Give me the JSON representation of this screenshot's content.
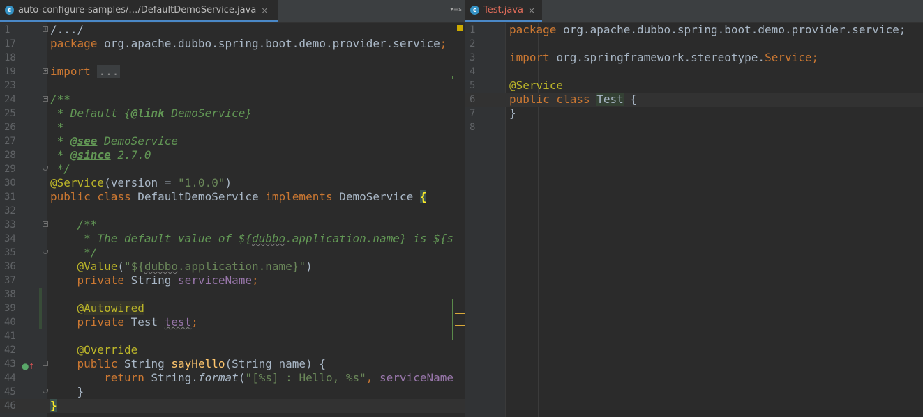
{
  "tabs": {
    "left": {
      "title": "auto-configure-samples/…/DefaultDemoService.java",
      "close": "×",
      "icon": "c-class-icon",
      "icon_label": "c"
    },
    "right": {
      "title": "Test.java",
      "close": "×",
      "icon": "c-class-icon",
      "icon_label": "c"
    },
    "menu_label": "▾≡s"
  },
  "colors": {
    "background": "#2b2b2b",
    "keyword": "#cc7832",
    "annotation": "#bbb529",
    "string": "#6a8759",
    "doc": "#629755",
    "field": "#9876aa",
    "method": "#ffc66d",
    "tab_accent": "#4a88c7"
  },
  "left_editor": {
    "lines": [
      {
        "n": "1",
        "t": "/.../"
      },
      {
        "n": "17",
        "t": "org.apache.dubbo.spring.boot.demo.provider.service",
        "kw": "package "
      },
      {
        "n": "18",
        "t": ""
      },
      {
        "n": "19",
        "kw": "import ",
        "t": "..."
      },
      {
        "n": "23",
        "t": ""
      },
      {
        "n": "24",
        "t": "/**"
      },
      {
        "n": "25",
        "pre": " * Default {",
        "tag": "@link",
        "post": " DemoService}"
      },
      {
        "n": "26",
        "t": " *"
      },
      {
        "n": "27",
        "pre": " * ",
        "tag": "@see",
        "post": " DemoService"
      },
      {
        "n": "28",
        "pre": " * ",
        "tag": "@since",
        "post": " 2.7.0"
      },
      {
        "n": "29",
        "t": " */"
      },
      {
        "n": "30",
        "ann": "@Service",
        "a": "(version = ",
        "str": "\"1.0.0\"",
        "b": ")"
      },
      {
        "n": "31",
        "kw1": "public class ",
        "name": "DefaultDemoService ",
        "kw2": "implements ",
        "iface": "DemoService ",
        "brace": "{"
      },
      {
        "n": "32",
        "t": ""
      },
      {
        "n": "33",
        "t": "    /**"
      },
      {
        "n": "34",
        "pre": "     * The default value of ${",
        "wv": "dubbo",
        "post": ".application.name} is ${s"
      },
      {
        "n": "35",
        "t": "     */"
      },
      {
        "n": "36",
        "ind": "    ",
        "ann": "@Value",
        "a": "(",
        "s1": "\"${",
        "sw": "dubbo",
        "s2": ".application.name}\"",
        "b": ")"
      },
      {
        "n": "37",
        "ind": "    ",
        "kw": "private ",
        "type": "String ",
        "fld": "serviceName",
        "end": ";"
      },
      {
        "n": "38",
        "t": ""
      },
      {
        "n": "39",
        "ind": "    ",
        "at": "@",
        "hl": "Autowired"
      },
      {
        "n": "40",
        "ind": "    ",
        "kw": "private ",
        "type": "Test ",
        "fld": "test",
        "end": ";"
      },
      {
        "n": "41",
        "t": ""
      },
      {
        "n": "42",
        "ind": "    ",
        "ann": "@Override"
      },
      {
        "n": "43",
        "ind": "    ",
        "kw": "public ",
        "type": "String ",
        "fn": "sayHello",
        "a": "(String name) {"
      },
      {
        "n": "44",
        "ind": "        ",
        "kw": "return ",
        "type": "String.",
        "it": "format",
        "a": "(",
        "str": "\"[%s] : Hello, %s\"",
        "b": ", ",
        "fld": "serviceName"
      },
      {
        "n": "45",
        "t": "    }"
      },
      {
        "n": "46",
        "brace": "}"
      }
    ]
  },
  "right_editor": {
    "lines": [
      {
        "n": "1",
        "kw": "package ",
        "t": "org.apache.dubbo.spring.boot.demo.provider.service;"
      },
      {
        "n": "2",
        "t": ""
      },
      {
        "n": "3",
        "kw": "import ",
        "t": "org.springframework.stereotype.",
        "ann": "Service",
        "end": ";"
      },
      {
        "n": "4",
        "t": ""
      },
      {
        "n": "5",
        "ann": "@Service"
      },
      {
        "n": "6",
        "kw": "public class ",
        "name": "Test",
        "t": " {"
      },
      {
        "n": "7",
        "t": "}"
      },
      {
        "n": "8",
        "t": ""
      }
    ]
  }
}
